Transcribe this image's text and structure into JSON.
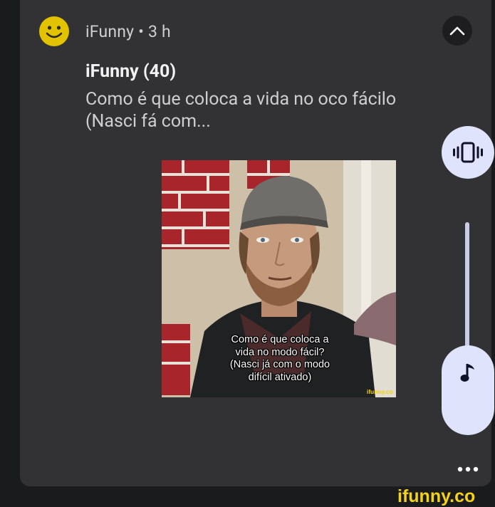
{
  "notification": {
    "app_name": "iFunny",
    "separator": "•",
    "time": "3 h",
    "title": "iFunny (40)",
    "body_line1": "Como é que coloca a vida no oco fácilo",
    "body_line2": "(Nasci fá com...",
    "app_icon": "smiley-face-icon",
    "collapse_icon": "chevron-up-icon"
  },
  "image": {
    "caption_line1": "Como é que coloca a",
    "caption_line2": "vida no modo fácil?",
    "caption_line3": "(Nasci já com o modo",
    "caption_line4": "difícil ativado)",
    "watermark": "ifunny.co"
  },
  "volume_panel": {
    "ringer_mode_icon": "vibrate-icon",
    "stream_icon": "music-note-icon",
    "more_icon": "more-dots-icon"
  },
  "watermark": {
    "text": "ifunny.co"
  },
  "colors": {
    "background": "#1a1b1d",
    "card": "#323234",
    "accent_panel": "#dfe3fb",
    "ifunny_yellow": "#f5d21a"
  }
}
